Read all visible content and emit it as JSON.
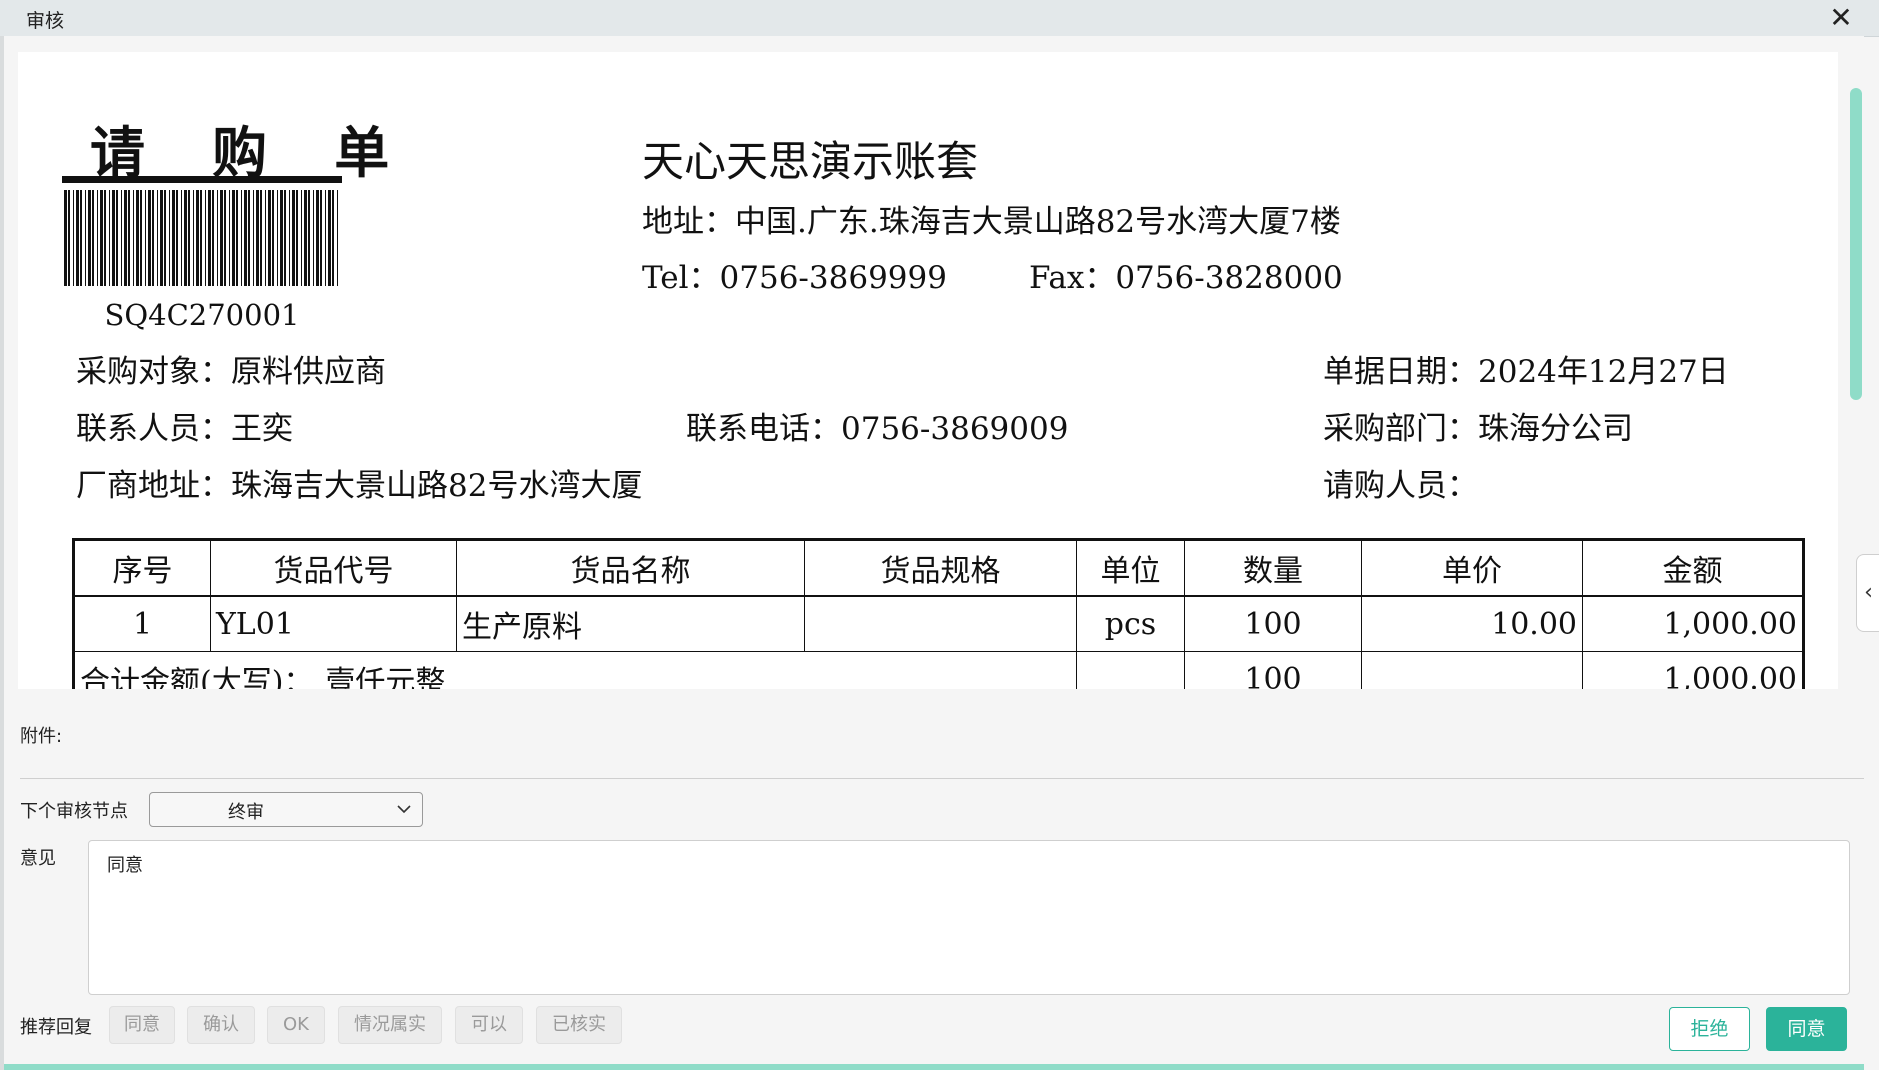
{
  "window": {
    "title": "审核",
    "close_icon": "close-icon"
  },
  "document": {
    "title": "请 购 单",
    "barcode_text": "SQ4C270001",
    "company": "天心天思演示账套",
    "address": "地址：中国.广东.珠海吉大景山路82号水湾大厦7楼",
    "tel": "Tel：0756-3869999",
    "fax": "Fax：0756-3828000",
    "fields": {
      "purchase_target": "采购对象：原料供应商",
      "doc_date": "单据日期：2024年12月27日",
      "contact_person": "联系人员：王奕",
      "contact_phone": "联系电话：0756-3869009",
      "purchase_dept": "采购部门：珠海分公司",
      "vendor_address": "厂商地址：珠海吉大景山路82号水湾大厦",
      "requester": "请购人员："
    },
    "table": {
      "headers": [
        "序号",
        "货品代号",
        "货品名称",
        "货品规格",
        "单位",
        "数量",
        "单价",
        "金额"
      ],
      "rows": [
        {
          "seq": "1",
          "code": "YL01",
          "name": "生产原料",
          "spec": "",
          "unit": "pcs",
          "qty": "100",
          "price": "10.00",
          "amount": "1,000.00"
        }
      ],
      "total": {
        "label": "合计金额(大写)：",
        "words": "壹仟元整",
        "qty": "100",
        "amount": "1,000.00"
      }
    }
  },
  "audit": {
    "attachment_label": "附件:",
    "next_node_label": "下个审核节点",
    "next_node_value": "终审",
    "opinion_label": "意见",
    "opinion_value": "同意",
    "recommend_label": "推荐回复",
    "recommend_replies": [
      "同意",
      "确认",
      "OK",
      "情况属实",
      "可以",
      "已核实"
    ],
    "reject_label": "拒绝",
    "accept_label": "同意"
  },
  "colors": {
    "accent": "#2bb39a",
    "scrollbar": "#8fdcc8",
    "titlebar": "#e3e8ea"
  }
}
